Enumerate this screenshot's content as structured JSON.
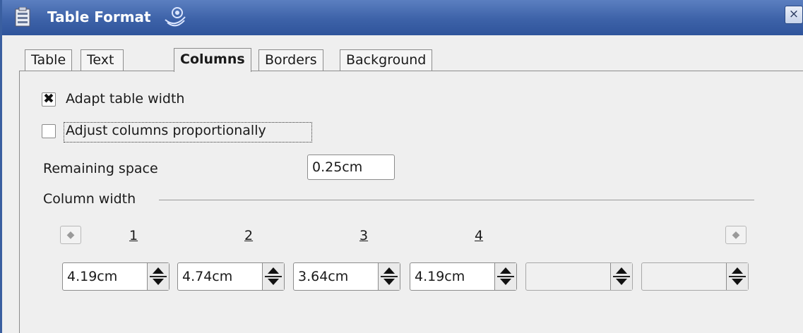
{
  "window": {
    "title": "Table Format",
    "close": "×"
  },
  "tabs": [
    {
      "label": "Table",
      "active": false
    },
    {
      "label": "Text Flow",
      "active": false
    },
    {
      "label": "Columns",
      "active": true
    },
    {
      "label": "Borders",
      "active": false
    },
    {
      "label": "Background",
      "active": false
    }
  ],
  "options": {
    "adapt_width": {
      "label": "Adapt table width",
      "checked": true
    },
    "adjust_proportionally": {
      "label": "Adjust columns proportionally",
      "checked": false
    }
  },
  "remaining_space": {
    "label": "Remaining space",
    "value": "0.25cm"
  },
  "column_width": {
    "section_label": "Column width",
    "prev_icon": "left-arrow-icon",
    "next_icon": "right-arrow-icon",
    "columns": [
      "1",
      "2",
      "3",
      "4"
    ],
    "values": [
      "4.19cm",
      "4.74cm",
      "3.64cm",
      "4.19cm",
      "",
      ""
    ]
  }
}
